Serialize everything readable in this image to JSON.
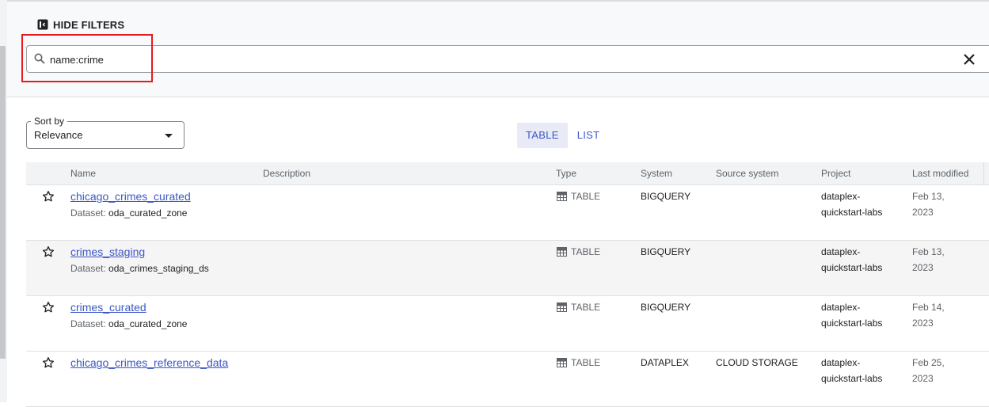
{
  "filters": {
    "hide_label": "HIDE FILTERS"
  },
  "search": {
    "value": "name:crime"
  },
  "sort": {
    "label": "Sort by",
    "value": "Relevance"
  },
  "view": {
    "table_label": "TABLE",
    "list_label": "LIST",
    "active": "TABLE"
  },
  "table": {
    "headers": {
      "name": "Name",
      "description": "Description",
      "type": "Type",
      "system": "System",
      "source": "Source system",
      "project": "Project",
      "modified": "Last modified"
    },
    "dataset_label": "Dataset:",
    "rows": [
      {
        "name": "chicago_crimes_curated",
        "dataset": "oda_curated_zone",
        "type": "TABLE",
        "system": "BIGQUERY",
        "source": "",
        "project": "dataplex-quickstart-labs",
        "modified": "Feb 13, 2023"
      },
      {
        "name": "crimes_staging",
        "dataset": "oda_crimes_staging_ds",
        "type": "TABLE",
        "system": "BIGQUERY",
        "source": "",
        "project": "dataplex-quickstart-labs",
        "modified": "Feb 13, 2023"
      },
      {
        "name": "crimes_curated",
        "dataset": "oda_curated_zone",
        "type": "TABLE",
        "system": "BIGQUERY",
        "source": "",
        "project": "dataplex-quickstart-labs",
        "modified": "Feb 14, 2023"
      },
      {
        "name": "chicago_crimes_reference_data",
        "dataset": "",
        "type": "TABLE",
        "system": "DATAPLEX",
        "source": "CLOUD STORAGE",
        "project": "dataplex-quickstart-labs",
        "modified": "Feb 25, 2023"
      }
    ]
  },
  "colors": {
    "accent": "#3c57c7",
    "highlight": "#e8191f"
  }
}
